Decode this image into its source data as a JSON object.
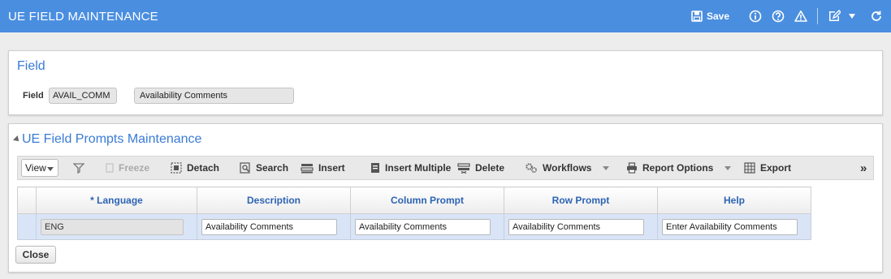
{
  "window": {
    "title": "UE FIELD MAINTENANCE"
  },
  "topbar": {
    "save_label": "Save",
    "icons": [
      "save-icon",
      "info-icon",
      "help-icon",
      "warning-icon",
      "edit-icon",
      "dropdown-icon",
      "refresh-icon"
    ]
  },
  "field_panel": {
    "title": "Field",
    "field_label": "Field",
    "field_code": "AVAIL_COMM",
    "field_description": "Availability Comments"
  },
  "grid_panel": {
    "title": "UE Field Prompts Maintenance",
    "toolbar": {
      "view_label": "View",
      "freeze_label": "Freeze",
      "detach_label": "Detach",
      "search_label": "Search",
      "insert_label": "Insert",
      "insert_multiple_label": "Insert Multiple",
      "delete_label": "Delete",
      "workflows_label": "Workflows",
      "report_options_label": "Report Options",
      "export_label": "Export"
    },
    "columns": [
      "* Language",
      "Description",
      "Column Prompt",
      "Row Prompt",
      "Help"
    ],
    "rows": [
      {
        "language": "ENG",
        "description": "Availability Comments",
        "column_prompt": "Availability Comments",
        "row_prompt": "Availability Comments",
        "help": "Enter Availability Comments"
      }
    ],
    "close_label": "Close"
  },
  "colors": {
    "accent": "#4a8ee0",
    "title_text": "#3a7bd5",
    "row_selected": "#d9e5f7"
  }
}
